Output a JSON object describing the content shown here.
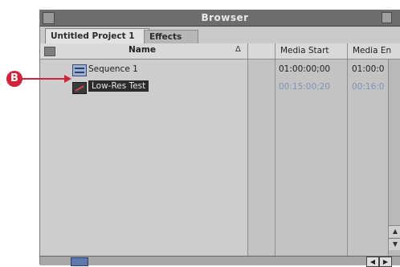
{
  "window": {
    "title": "Browser"
  },
  "tabs": [
    {
      "label": "Untitled Project 1",
      "active": true
    },
    {
      "label": "Effects",
      "active": false
    }
  ],
  "columns": {
    "name": "Name",
    "sort_indicator": "Δ",
    "media_start": "Media Start",
    "media_end": "Media En"
  },
  "rows": [
    {
      "icon": "sequence-icon",
      "name": "Sequence 1",
      "media_start": "01:00:00;00",
      "media_end": "01:00:0",
      "selected": false
    },
    {
      "icon": "clip-icon",
      "name": "Low-Res Test",
      "media_start": "00:15:00;20",
      "media_end": "00:16:0",
      "selected": true
    }
  ],
  "callout": {
    "label": "B",
    "color": "#d2233c"
  }
}
